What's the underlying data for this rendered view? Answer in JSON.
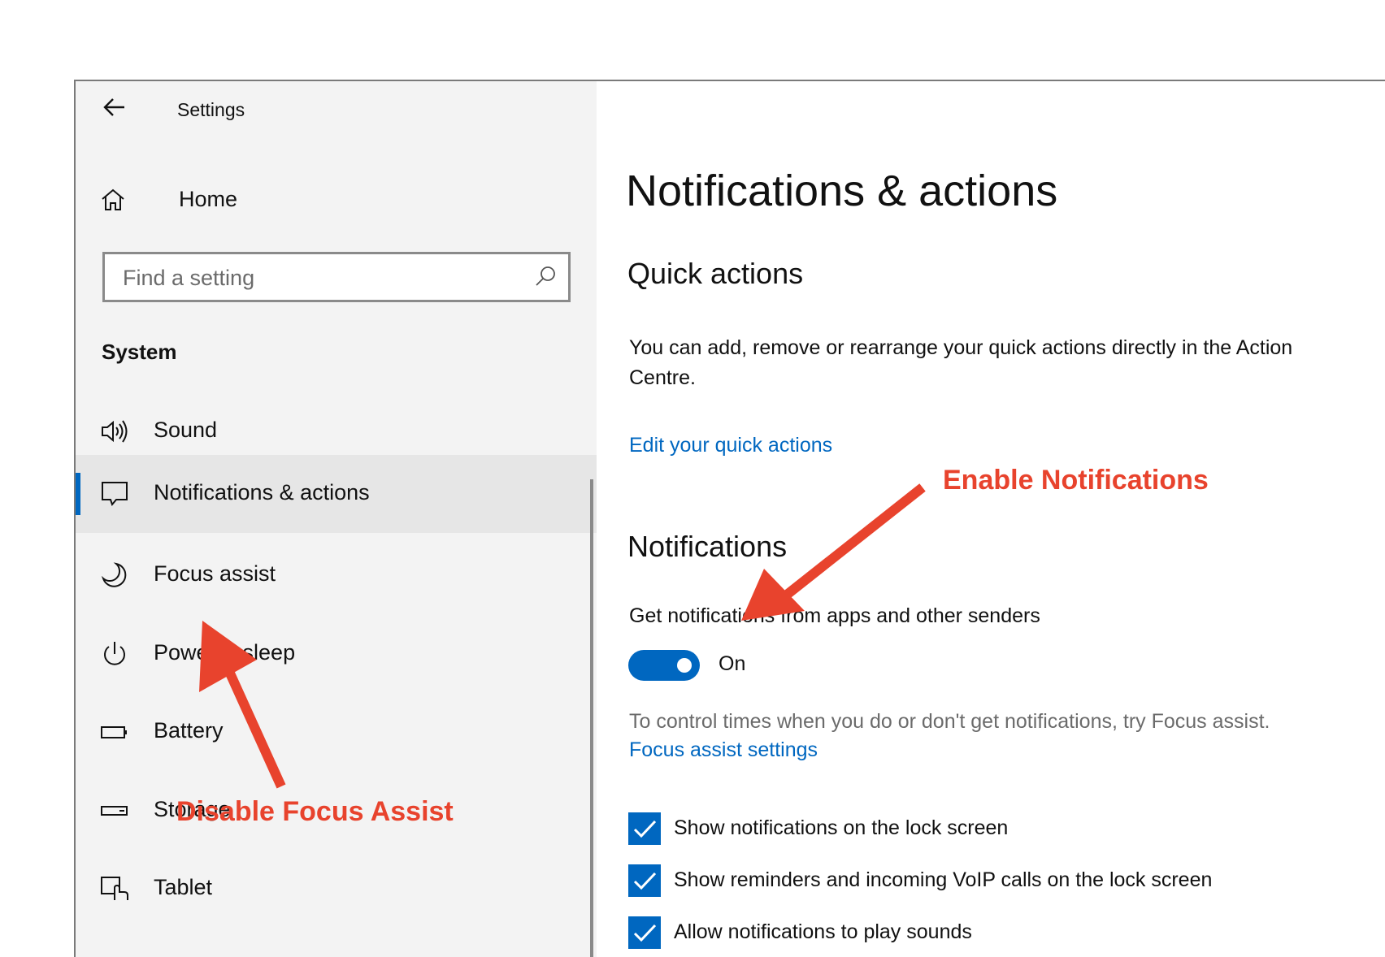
{
  "window": {
    "title": "Settings"
  },
  "sidebar": {
    "home_label": "Home",
    "search_placeholder": "Find a setting",
    "section_label": "System",
    "items": [
      {
        "label": "Sound",
        "icon": "speaker-icon"
      },
      {
        "label": "Notifications & actions",
        "icon": "message-icon",
        "selected": true
      },
      {
        "label": "Focus assist",
        "icon": "moon-icon"
      },
      {
        "label": "Power & sleep",
        "icon": "power-icon"
      },
      {
        "label": "Battery",
        "icon": "battery-icon"
      },
      {
        "label": "Storage",
        "icon": "storage-icon"
      },
      {
        "label": "Tablet",
        "icon": "tablet-icon"
      }
    ]
  },
  "main": {
    "page_title": "Notifications & actions",
    "quick_actions": {
      "heading": "Quick actions",
      "description": "You can add, remove or rearrange your quick actions directly in the Action Centre.",
      "link": "Edit your quick actions"
    },
    "notifications": {
      "heading": "Notifications",
      "toggle_label": "Get notifications from apps and other senders",
      "toggle_state": "On",
      "toggle_on": true,
      "hint": "To control times when you do or don't get notifications, try Focus assist.",
      "hint_link": "Focus assist settings",
      "checkboxes": [
        {
          "label": "Show notifications on the lock screen",
          "checked": true
        },
        {
          "label": "Show reminders and incoming VoIP calls on the lock screen",
          "checked": true
        },
        {
          "label": "Allow notifications to play sounds",
          "checked": true
        }
      ]
    }
  },
  "annotations": {
    "enable": "Enable Notifications",
    "disable": "Disable Focus Assist",
    "color": "#e8432d"
  },
  "colors": {
    "accent": "#0067c0",
    "sidebar_bg": "#f3f3f3",
    "selected_bg": "#e6e6e6"
  }
}
